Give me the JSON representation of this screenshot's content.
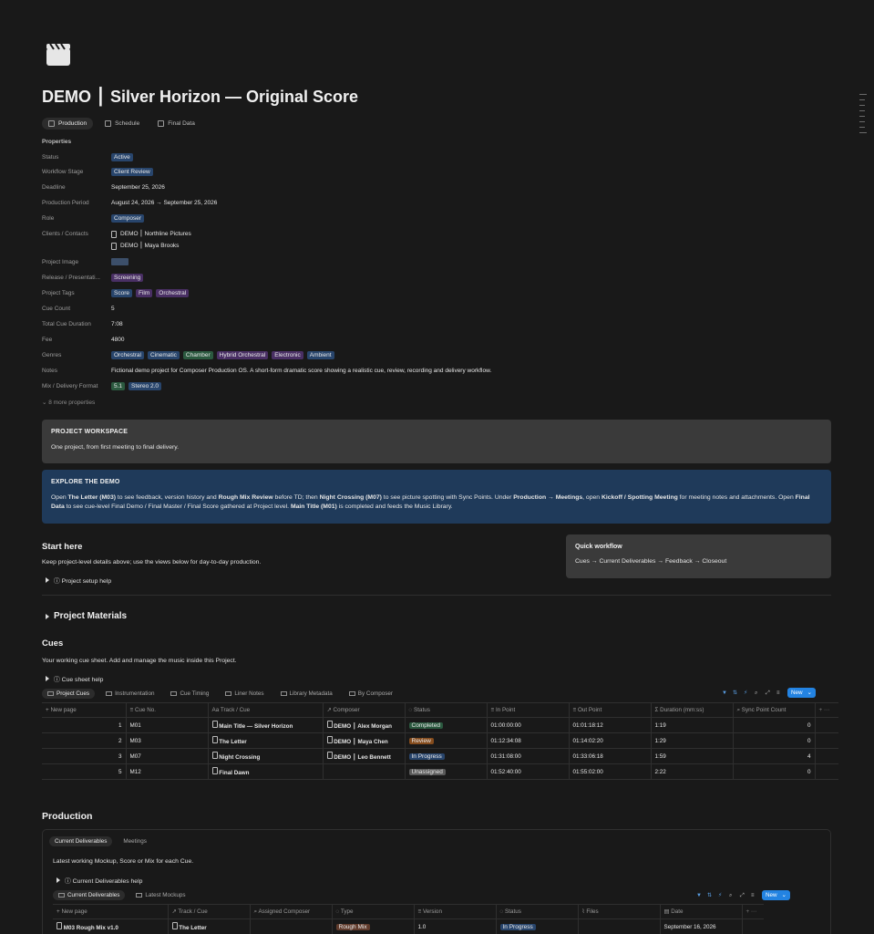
{
  "page": {
    "title": "DEMO ⎮ Silver Horizon — Original Score",
    "icon": "clapperboard-icon"
  },
  "top_tabs": [
    {
      "label": "Production",
      "active": true
    },
    {
      "label": "Schedule",
      "active": false
    },
    {
      "label": "Final Data",
      "active": false
    }
  ],
  "properties": {
    "heading": "Properties",
    "status": {
      "name": "Status",
      "value": "Active"
    },
    "workflow_stage": {
      "name": "Workflow Stage",
      "value": "Client Review"
    },
    "deadline": {
      "name": "Deadline",
      "value": "September 25, 2026"
    },
    "production_period": {
      "name": "Production Period",
      "value": "August 24, 2026 → September 25, 2026"
    },
    "role": {
      "name": "Role",
      "value": "Composer"
    },
    "clients": {
      "name": "Clients / Contacts",
      "values": [
        "DEMO ⎮ Northline Pictures",
        "DEMO ⎮ Maya Brooks"
      ]
    },
    "project_image": {
      "name": "Project Image"
    },
    "release": {
      "name": "Release / Presentati...",
      "value": "Screening"
    },
    "project_tags": {
      "name": "Project Tags",
      "values": [
        "Score",
        "Film",
        "Orchestral"
      ]
    },
    "cue_count": {
      "name": "Cue Count",
      "value": "5"
    },
    "total_cue_duration": {
      "name": "Total Cue Duration",
      "value": "7:08"
    },
    "fee": {
      "name": "Fee",
      "value": "4800"
    },
    "genres": {
      "name": "Genres",
      "values": [
        "Orchestral",
        "Cinematic",
        "Chamber",
        "Hybrid Orchestral",
        "Electronic",
        "Ambient"
      ]
    },
    "notes": {
      "name": "Notes",
      "value": "Fictional demo project for Composer Production OS. A short-form dramatic score showing a realistic cue, review, recording and delivery workflow."
    },
    "mix_format": {
      "name": "Mix / Delivery Format",
      "values": [
        "5.1",
        "Stereo 2.0"
      ]
    },
    "more": "8 more properties"
  },
  "workspace": {
    "heading": "PROJECT WORKSPACE",
    "text": "One project, from first meeting to final delivery."
  },
  "explore": {
    "heading": "EXPLORE THE DEMO",
    "p1": "Open ",
    "b1": "The Letter (M03)",
    "p2": " to see feedback, version history and ",
    "b2": "Rough Mix Review",
    "p3": " before TD; then ",
    "b3": "Night Crossing (M07)",
    "p4": " to see picture spotting with Sync Points. Under ",
    "b4": "Production → Meetings",
    "p5": ", open ",
    "b5": "Kickoff / Spotting Meeting",
    "p6": " for meeting notes and attachments. Open ",
    "b6": "Final Data",
    "p7": " to see cue-level Final Demo / Final Master / Final Score gathered at Project level. ",
    "b7": "Main Title (M01)",
    "p8": " is completed and feeds the Music Library."
  },
  "start_here": {
    "heading": "Start here",
    "text": "Keep project-level details above; use the views below for day-to-day production.",
    "toggle": "ⓘ Project setup help"
  },
  "quick_workflow": {
    "heading": "Quick workflow",
    "text": "Cues → Current Deliverables → Feedback → Closeout"
  },
  "project_materials": {
    "label": "Project Materials"
  },
  "cues": {
    "heading": "Cues",
    "text": "Your working cue sheet. Add and manage the music inside this Project.",
    "toggle": "ⓘ Cue sheet help",
    "views": [
      "Project Cues",
      "Instrumentation",
      "Cue Timing",
      "Liner Notes",
      "Library Metadata",
      "By Composer"
    ],
    "new_label": "New",
    "columns": [
      "New page",
      "Cue No.",
      "Track / Cue",
      "Composer",
      "Status",
      "In Point",
      "Out Point",
      "Duration (mm:ss)",
      "Sync Point Count"
    ],
    "rows": [
      {
        "n": "1",
        "cue": "M01",
        "track": "Main Title — Silver Horizon",
        "composer": "DEMO ⎮ Alex Morgan",
        "status": "Completed",
        "in": "01:00:00:00",
        "out": "01:01:18:12",
        "dur": "1:19",
        "sync": "0"
      },
      {
        "n": "2",
        "cue": "M03",
        "track": "The Letter",
        "composer": "DEMO ⎮ Maya Chen",
        "status": "Review",
        "in": "01:12:34:08",
        "out": "01:14:02:20",
        "dur": "1:29",
        "sync": "0"
      },
      {
        "n": "3",
        "cue": "M07",
        "track": "Night Crossing",
        "composer": "DEMO ⎮ Leo Bennett",
        "status": "In Progress",
        "in": "01:31:08:00",
        "out": "01:33:06:18",
        "dur": "1:59",
        "sync": "4"
      },
      {
        "n": "5",
        "cue": "M12",
        "track": "Final Dawn",
        "composer": "",
        "status": "Unassigned",
        "in": "01:52:40:00",
        "out": "01:55:02:00",
        "dur": "2:22",
        "sync": "0"
      }
    ]
  },
  "production": {
    "heading": "Production",
    "tabs": [
      "Current Deliverables",
      "Meetings"
    ],
    "text": "Latest working Mockup, Score or Mix for each Cue.",
    "toggle": "ⓘ Current Deliverables help",
    "views": [
      "Current Deliverables",
      "Latest Mockups"
    ],
    "new_label": "New",
    "columns": [
      "New page",
      "Track / Cue",
      "Assigned Composer",
      "Type",
      "Version",
      "Status",
      "Files",
      "Date"
    ],
    "rows": [
      {
        "name": "M03 Rough Mix v1.0",
        "track": "The Letter",
        "composer": "",
        "type": "Rough Mix",
        "version": "1.0",
        "status": "In Progress",
        "files": "",
        "date": "September 16, 2026"
      }
    ]
  },
  "colors": {
    "accent": "#2383e2",
    "background": "#191919"
  }
}
